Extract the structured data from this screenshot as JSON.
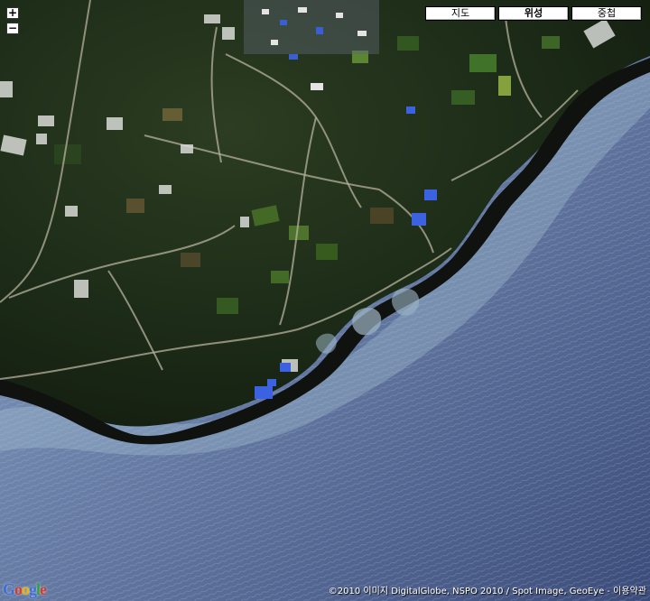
{
  "controls": {
    "zoom_in": "+",
    "zoom_out": "−"
  },
  "map_types": {
    "map": "지도",
    "satellite": "위성",
    "hybrid": "중첩",
    "selected": "satellite"
  },
  "logo": {
    "letters": [
      "G",
      "o",
      "o",
      "g",
      "l",
      "e"
    ],
    "colors": [
      "#3b6fd6",
      "#d33a2c",
      "#f0b400",
      "#3b6fd6",
      "#2f9e44",
      "#d33a2c"
    ]
  },
  "attribution": "©2010 이미지 DigitalGlobe, NSPO 2010 / Spot Image, GeoEye - 이용약관",
  "colors": {
    "land": "#1e2e1a",
    "sea": "#5a6e9a",
    "shore_rock": "#121512",
    "surf": "#a9c6d4"
  }
}
